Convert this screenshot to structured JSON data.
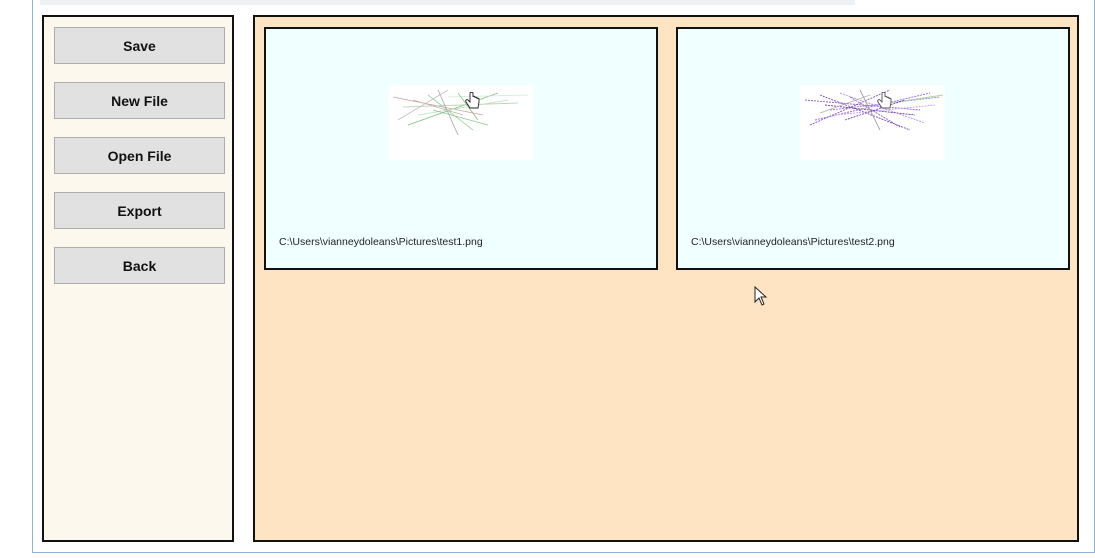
{
  "sidebar": {
    "buttons": [
      {
        "label": "Save"
      },
      {
        "label": "New File"
      },
      {
        "label": "Open File"
      },
      {
        "label": "Export"
      },
      {
        "label": "Back"
      }
    ]
  },
  "main": {
    "cards": [
      {
        "path": "C:\\Users\\vianneydoleans\\Pictures\\test1.png",
        "thumbnail_icon": "sketch-thumbnail"
      },
      {
        "path": "C:\\Users\\vianneydoleans\\Pictures\\test2.png",
        "thumbnail_icon": "sketch-thumbnail"
      }
    ]
  },
  "colors": {
    "sidebar_bg": "#fdf8ee",
    "main_bg": "#ffe4c4",
    "card_bg": "#f0ffff",
    "button_bg": "#e1e1e1"
  },
  "cursors": {
    "pointer_icon": "hand-cursor-icon",
    "arrow_icon": "arrow-cursor-icon"
  }
}
